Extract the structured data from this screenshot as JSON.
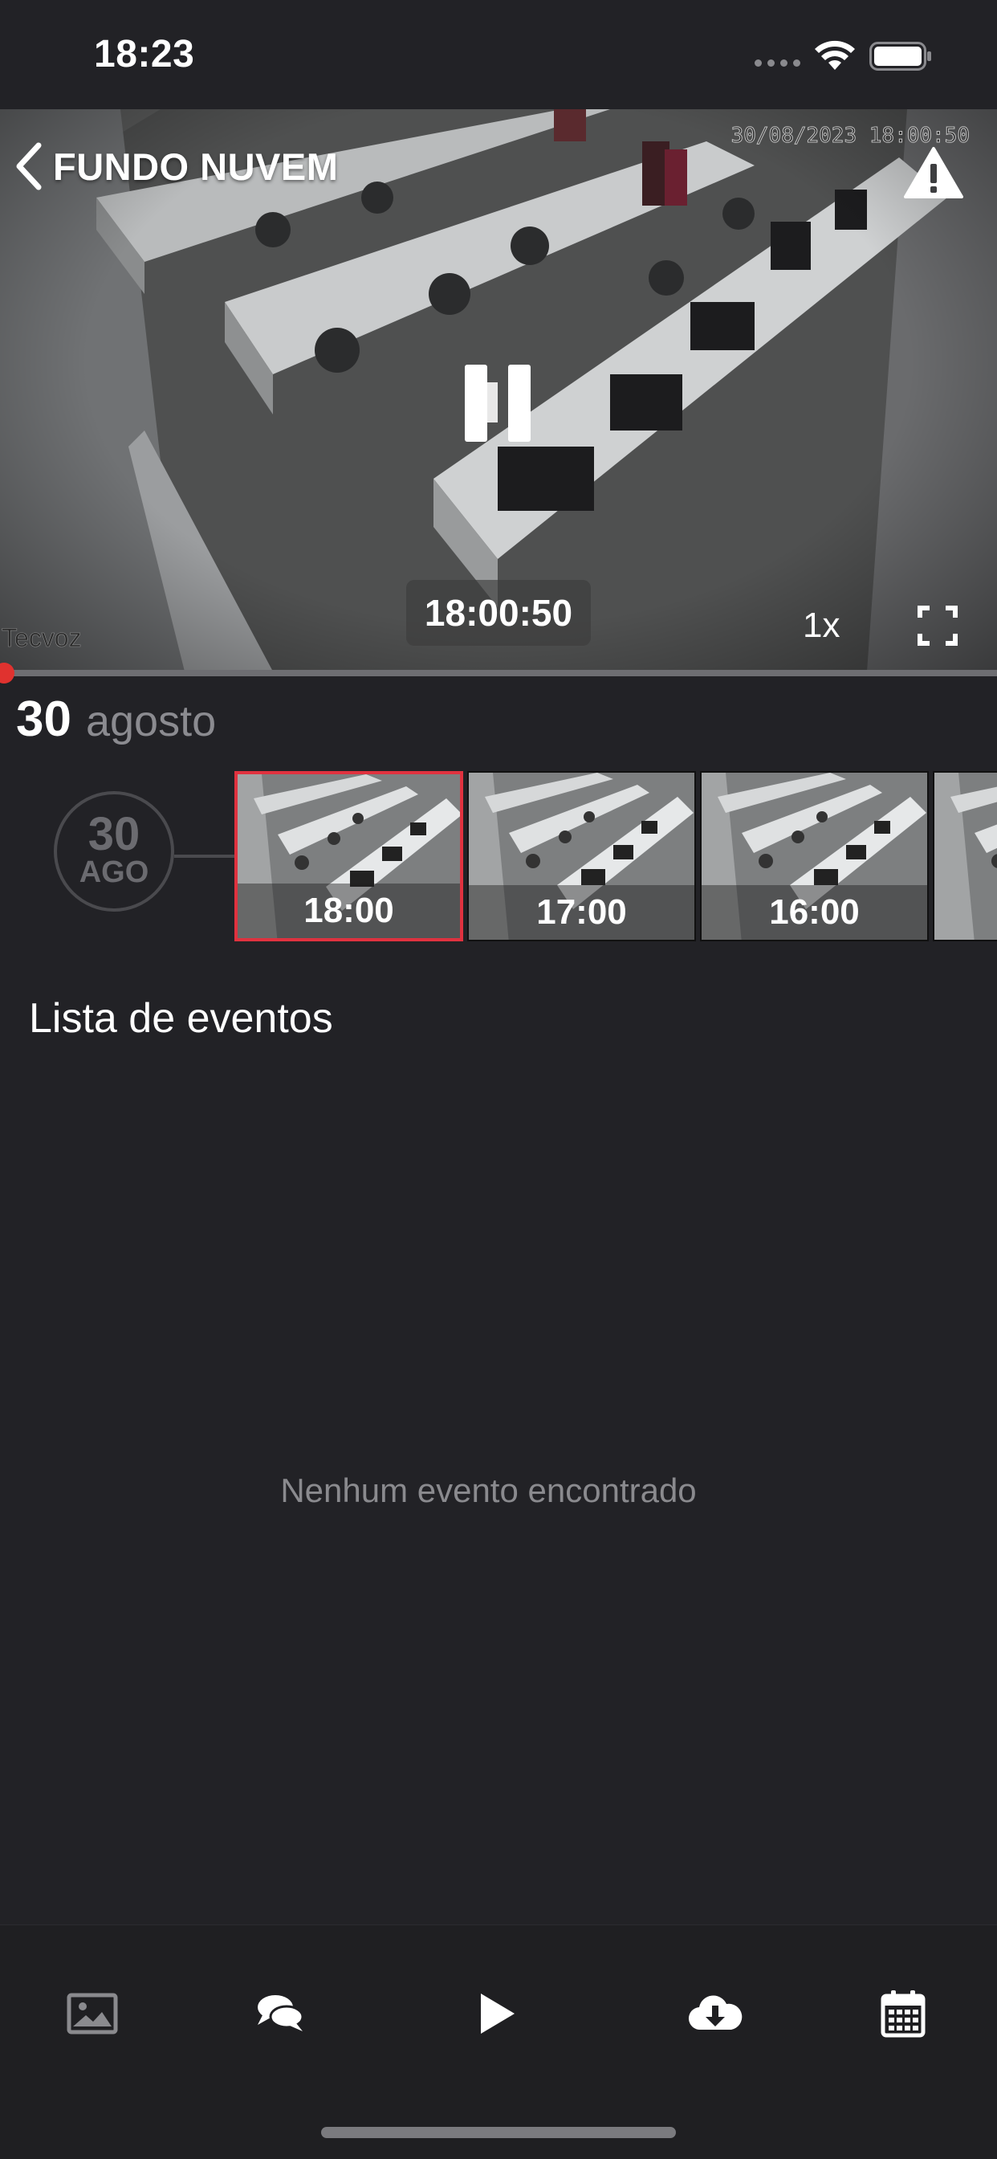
{
  "status_bar": {
    "time": "18:23"
  },
  "player": {
    "camera_name": "FUNDO NUVEM",
    "camera_timestamp": "30/08/2023 18:00:50",
    "current_time": "18:00:50",
    "watermark": "Tecvoz",
    "speed": "1x",
    "progress_fraction": 0.004
  },
  "date_header": {
    "day": "30",
    "month": "agosto"
  },
  "timeline": {
    "date_circle": {
      "day": "30",
      "month": "AGO"
    },
    "recordings": [
      {
        "time": "18:00",
        "selected": true
      },
      {
        "time": "17:00",
        "selected": false
      },
      {
        "time": "16:00",
        "selected": false
      },
      {
        "time": "",
        "selected": false
      }
    ]
  },
  "events": {
    "title": "Lista de eventos",
    "empty_message": "Nenhum evento encontrado"
  },
  "tab_bar": {
    "items": [
      {
        "icon": "image-icon"
      },
      {
        "icon": "chat-icon"
      },
      {
        "icon": "play-icon"
      },
      {
        "icon": "cloud-download-icon"
      },
      {
        "icon": "calendar-icon"
      }
    ]
  },
  "colors": {
    "background": "#222226",
    "accent": "#e0322f",
    "muted_text": "#8a8a8e"
  }
}
